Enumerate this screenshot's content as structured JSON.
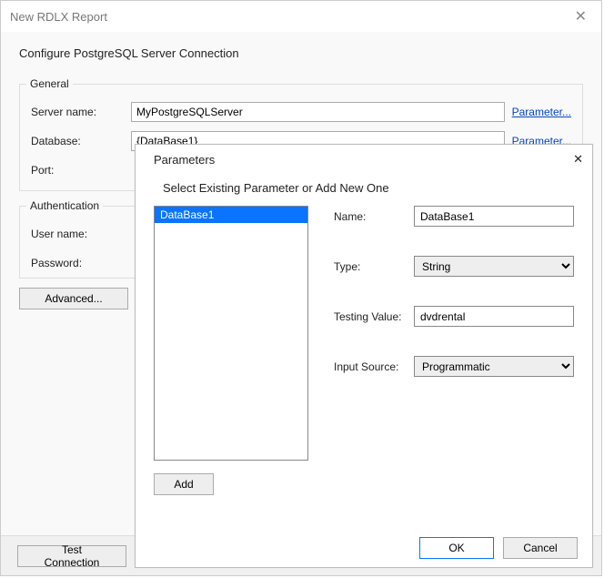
{
  "parent": {
    "title": "New RDLX Report",
    "close_glyph": "✕",
    "subtitle": "Configure PostgreSQL Server Connection",
    "general": {
      "legend": "General",
      "server_label": "Server name:",
      "server_value": "MyPostgreSQLServer",
      "server_param": "Parameter...",
      "database_label": "Database:",
      "database_value": "{DataBase1}",
      "database_param": "Parameter...",
      "port_label": "Port:"
    },
    "auth": {
      "legend": "Authentication",
      "user_label": "User name:",
      "password_label": "Password:"
    },
    "advanced_label": "Advanced...",
    "test_connection_label": "Test Connection"
  },
  "child": {
    "title": "Parameters",
    "close_glyph": "✕",
    "subtitle": "Select Existing Parameter or Add New One",
    "list": {
      "items": [
        {
          "label": "DataBase1",
          "selected": true
        }
      ]
    },
    "form": {
      "name_label": "Name:",
      "name_value": "DataBase1",
      "type_label": "Type:",
      "type_value": "String",
      "testing_label": "Testing Value:",
      "testing_value": "dvdrental",
      "source_label": "Input Source:",
      "source_value": "Programmatic"
    },
    "add_label": "Add",
    "ok_label": "OK",
    "cancel_label": "Cancel"
  }
}
